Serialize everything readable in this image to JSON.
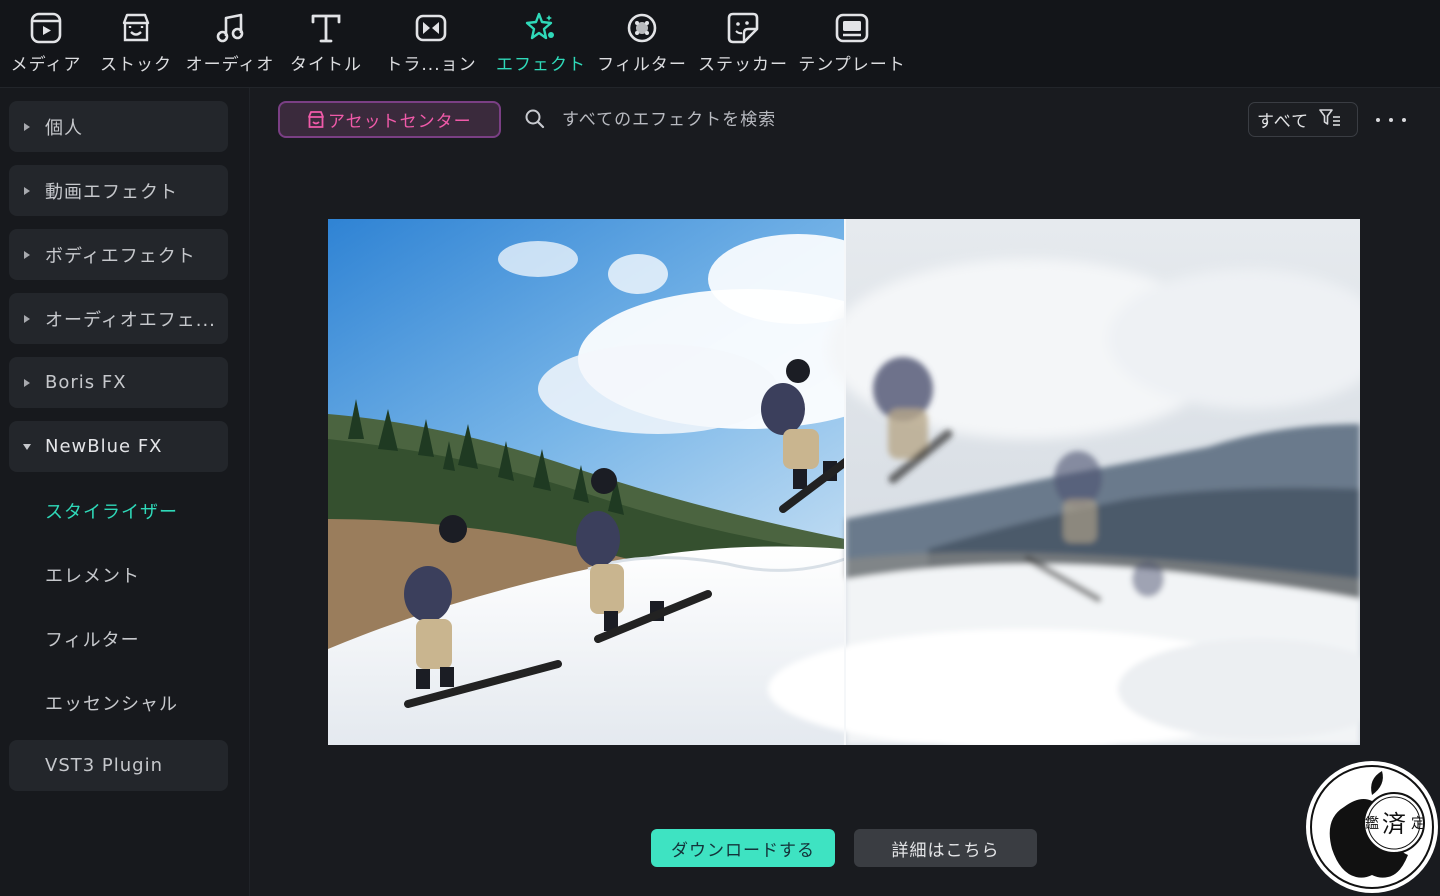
{
  "toolbar": {
    "items": [
      {
        "label": "メディア",
        "icon": "media-icon"
      },
      {
        "label": "ストック",
        "icon": "stock-icon"
      },
      {
        "label": "オーディオ",
        "icon": "audio-note-icon"
      },
      {
        "label": "タイトル",
        "icon": "title-text-icon"
      },
      {
        "label": "トラ...ョン",
        "icon": "transition-icon"
      },
      {
        "label": "エフェクト",
        "icon": "effect-sparkle-icon",
        "active": true
      },
      {
        "label": "フィルター",
        "icon": "filter-icon"
      },
      {
        "label": "ステッカー",
        "icon": "sticker-icon"
      },
      {
        "label": "テンプレート",
        "icon": "template-icon"
      }
    ]
  },
  "sidebar": {
    "categories": [
      {
        "label": "個人",
        "expanded": false
      },
      {
        "label": "動画エフェクト",
        "expanded": false
      },
      {
        "label": "ボディエフェクト",
        "expanded": false
      },
      {
        "label": "オーディオエフェ...",
        "expanded": false
      },
      {
        "label": "Boris FX",
        "expanded": false
      },
      {
        "label": "NewBlue FX",
        "expanded": true
      }
    ],
    "subitems": [
      {
        "label": "スタイライザー",
        "active": true
      },
      {
        "label": "エレメント"
      },
      {
        "label": "フィルター"
      },
      {
        "label": "エッセンシャル"
      }
    ],
    "vst": {
      "label": "VST3 Plugin"
    }
  },
  "main": {
    "asset_center_label": "アセットセンター",
    "search_placeholder": "すべてのエフェクトを検索",
    "filter_label": "すべて",
    "download_label": "ダウンロードする",
    "details_label": "詳細はこちら"
  },
  "watermark": {
    "text_main": "済",
    "text_left": "鑑",
    "text_right": "定"
  },
  "colors": {
    "accent": "#2fd9b9",
    "asset_pink": "#f05aa9",
    "download_bg": "#3ee3c2",
    "background": "#191b1f",
    "toolbar_bg": "#131519"
  }
}
